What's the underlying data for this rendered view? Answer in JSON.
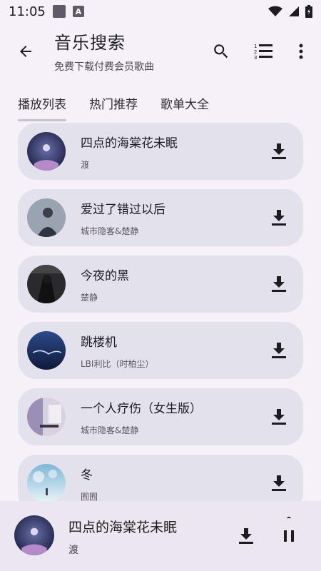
{
  "status": {
    "time": "11:05"
  },
  "app_bar": {
    "title": "音乐搜索",
    "subtitle": "免费下载付费会员歌曲"
  },
  "tabs": [
    {
      "label": "播放列表",
      "active": true
    },
    {
      "label": "热门推荐",
      "active": false
    },
    {
      "label": "歌单大全",
      "active": false
    }
  ],
  "songs": [
    {
      "title": "四点的海棠花未眠",
      "artist": "渡"
    },
    {
      "title": "爱过了错过以后",
      "artist": "城市隐客&楚静"
    },
    {
      "title": "今夜的黑",
      "artist": "楚静"
    },
    {
      "title": "跳楼机",
      "artist": "LBI利比（时柏尘）"
    },
    {
      "title": "一个人疗伤（女生版）",
      "artist": "城市隐客&楚静"
    },
    {
      "title": "冬",
      "artist": "囿囿"
    }
  ],
  "player": {
    "title": "四点的海棠花未眠",
    "artist": "渡"
  },
  "icons": {
    "back": "arrow-back-icon",
    "search": "search-icon",
    "playlist": "numbered-list-icon",
    "more": "more-vert-icon",
    "download": "download-icon",
    "pause": "pause-icon"
  },
  "colors": {
    "background": "#f6f1f8",
    "card": "#e3e2ec",
    "player": "#ece6f0",
    "text": "#1f1b23"
  }
}
